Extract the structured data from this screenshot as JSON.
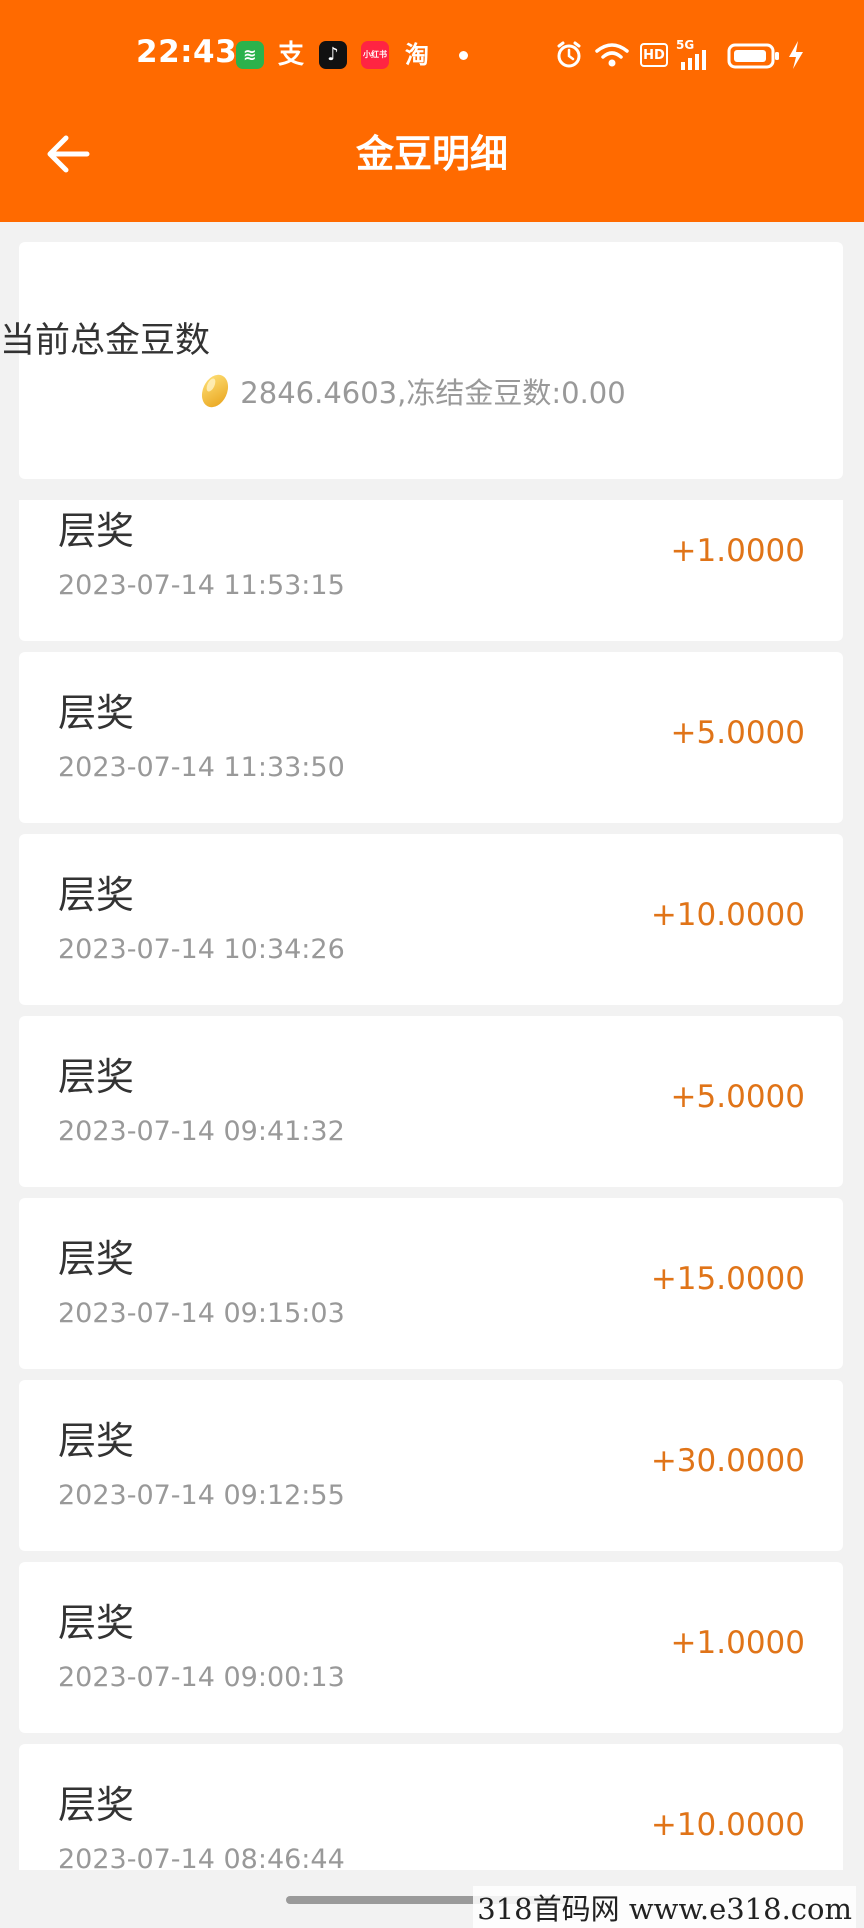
{
  "status_bar": {
    "time": "22:43",
    "apps": [
      {
        "icon": "wechat-mini-icon",
        "glyph": "≋",
        "bg": "#2bb24c"
      },
      {
        "icon": "alipay-icon",
        "glyph": "支",
        "bg": "transparent"
      },
      {
        "icon": "douyin-icon",
        "glyph": "♪",
        "bg": "#111111"
      },
      {
        "icon": "xiaohongshu-icon",
        "glyph": "小红书",
        "bg": "#ff2442"
      },
      {
        "icon": "taobao-icon",
        "glyph": "淘",
        "bg": "transparent"
      }
    ],
    "hd": "HD",
    "network": "5G"
  },
  "header": {
    "title": "金豆明细"
  },
  "summary": {
    "title": "当前总金豆数",
    "total": "2846.4603",
    "frozen_label": ",冻结金豆数:",
    "frozen": "0.00"
  },
  "records": [
    {
      "title": "层奖",
      "time": "2023-07-14 11:53:15",
      "amount": "+1.0000"
    },
    {
      "title": "层奖",
      "time": "2023-07-14 11:33:50",
      "amount": "+5.0000"
    },
    {
      "title": "层奖",
      "time": "2023-07-14 10:34:26",
      "amount": "+10.0000"
    },
    {
      "title": "层奖",
      "time": "2023-07-14 09:41:32",
      "amount": "+5.0000"
    },
    {
      "title": "层奖",
      "time": "2023-07-14 09:15:03",
      "amount": "+15.0000"
    },
    {
      "title": "层奖",
      "time": "2023-07-14 09:12:55",
      "amount": "+30.0000"
    },
    {
      "title": "层奖",
      "time": "2023-07-14 09:00:13",
      "amount": "+1.0000"
    },
    {
      "title": "层奖",
      "time": "2023-07-14 08:46:44",
      "amount": "+10.0000"
    }
  ],
  "watermark": "318首码网  www.e318.com",
  "colors": {
    "brand": "#ff6a00",
    "amount": "#e07418",
    "background": "#f2f2f2"
  }
}
